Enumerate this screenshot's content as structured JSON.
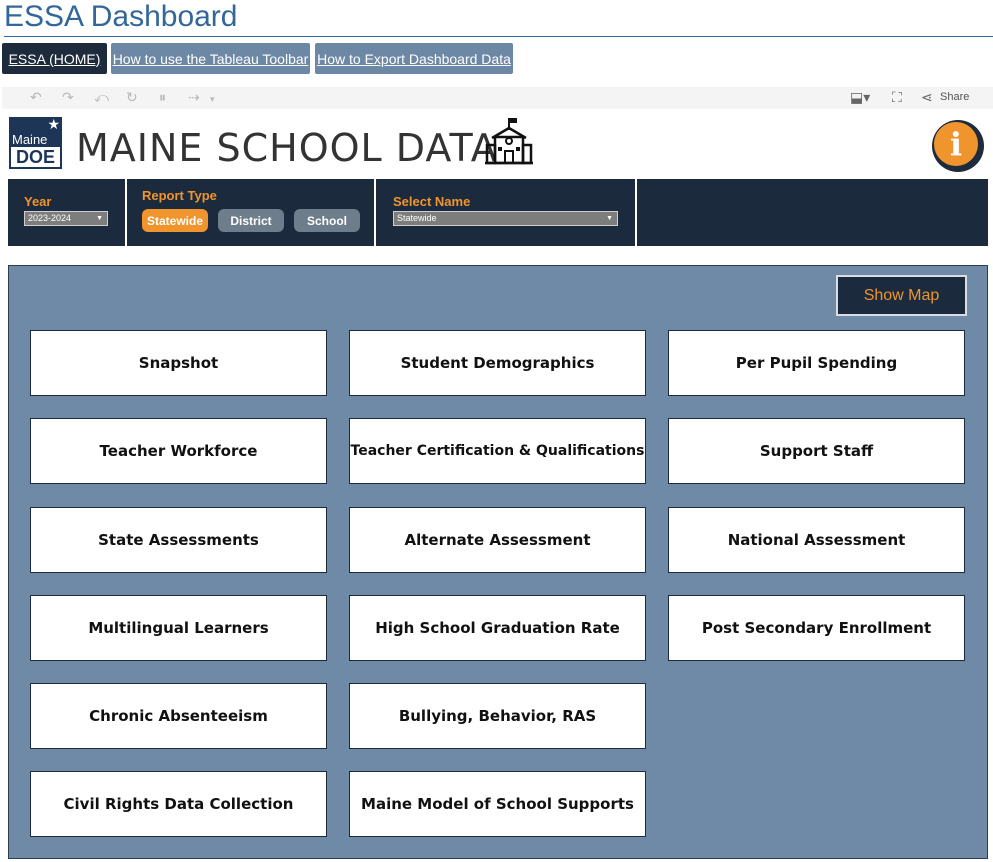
{
  "page": {
    "title": "ESSA Dashboard"
  },
  "nav": {
    "home": "ESSA (HOME)",
    "toolbar_help": "How to use the Tableau Toolbar",
    "export_help": "How to Export Dashboard Data"
  },
  "toolbar": {
    "left_icons": [
      "undo-icon",
      "redo-icon",
      "revert-icon",
      "refresh-icon",
      "pause-icon",
      "replay-icon"
    ],
    "right_icons": [
      "download-icon",
      "fullscreen-icon",
      "share-icon"
    ],
    "share_label": "Share"
  },
  "header": {
    "logo_top": "Maine",
    "logo_bottom": "DOE",
    "title": "MAINE SCHOOL DATA",
    "school_icon": "school-building-icon",
    "info_icon": "info-icon"
  },
  "filters": {
    "year_label": "Year",
    "year_value": "2023-2024",
    "report_type_label": "Report Type",
    "report_types": [
      "Statewide",
      "District",
      "School"
    ],
    "report_type_selected": "Statewide",
    "select_name_label": "Select Name",
    "select_name_value": "Statewide"
  },
  "panel": {
    "show_map": "Show Map",
    "tiles": [
      "Snapshot",
      "Student Demographics",
      "Per Pupil Spending",
      "Teacher Workforce",
      "Teacher Certification & Qualifications",
      "Support Staff",
      "State Assessments",
      "Alternate Assessment",
      "National Assessment",
      "Multilingual Learners",
      "High School Graduation Rate",
      "Post Secondary Enrollment",
      "Chronic Absenteeism",
      "Bullying, Behavior, RAS",
      "Civil Rights Data Collection",
      "Maine Model of School Supports"
    ]
  },
  "colors": {
    "navy": "#1b2a3c",
    "accent_orange": "#f0952d",
    "panel_blue": "#6e8aa7",
    "title_blue": "#336699"
  }
}
